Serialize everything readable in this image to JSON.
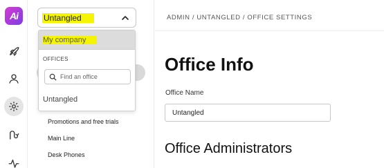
{
  "app": {
    "logo_text": "Ai"
  },
  "rail": {
    "items": [
      {
        "icon": "rocket-icon"
      },
      {
        "icon": "user-icon"
      },
      {
        "icon": "gear-icon",
        "active": true
      },
      {
        "icon": "route-icon"
      },
      {
        "icon": "activity-icon"
      }
    ]
  },
  "office_selector": {
    "selected": "Untangled",
    "icon": "chevron-up-icon"
  },
  "dropdown": {
    "company_label": "My company",
    "section_label": "OFFICES",
    "search_placeholder": "Find an office",
    "search_icon": "search-icon",
    "offices": [
      "Untangled"
    ]
  },
  "nav": {
    "items": [
      "Promotions and free trials",
      "Main Line",
      "Desk Phones"
    ]
  },
  "breadcrumb": "ADMIN / UNTANGLED / OFFICE SETTINGS",
  "main": {
    "title": "Office Info",
    "office_name_label": "Office Name",
    "office_name_value": "Untangled",
    "admins_title": "Office Administrators"
  },
  "colors": {
    "highlight": "#f5f500",
    "logo_gradient_start": "#d63ad1",
    "logo_gradient_end": "#7b3fe4",
    "active_bg": "#e4e4e4"
  }
}
